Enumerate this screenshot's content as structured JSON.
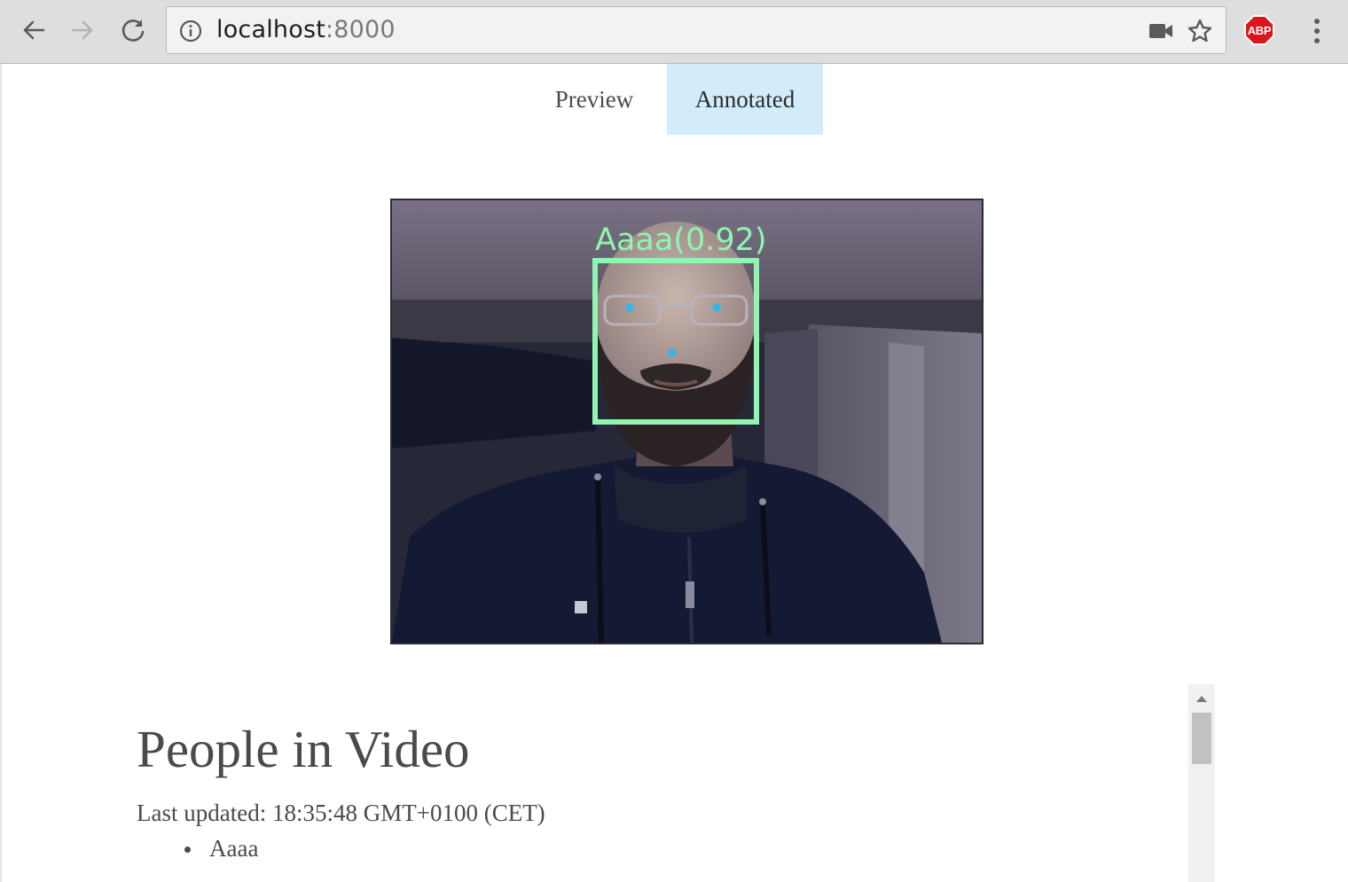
{
  "browser": {
    "url_host": "localhost",
    "url_port": ":8000",
    "icons": {
      "back": "arrow-left-icon",
      "forward": "arrow-right-icon",
      "reload": "reload-icon",
      "info": "info-icon",
      "camera": "camera-icon",
      "bookmark": "star-icon",
      "extension": "adblock-plus-icon",
      "menu": "kebab-menu-icon"
    },
    "extension_label": "ABP"
  },
  "tabs": [
    {
      "label": "Preview",
      "active": false
    },
    {
      "label": "Annotated",
      "active": true
    }
  ],
  "video": {
    "detection_label": "Aaaa(0.92)",
    "box_color": "#8ff5b0",
    "landmark_color": "#2bb7f0"
  },
  "people": {
    "title": "People in Video",
    "last_updated_label": "Last updated:",
    "last_updated_time": "18:35:48 GMT+0100 (CET)",
    "list": [
      "Aaaa"
    ]
  },
  "colors": {
    "active_tab_bg": "#d2ecfb",
    "text": "#4a4a4a",
    "abp_red": "#d8161b"
  }
}
